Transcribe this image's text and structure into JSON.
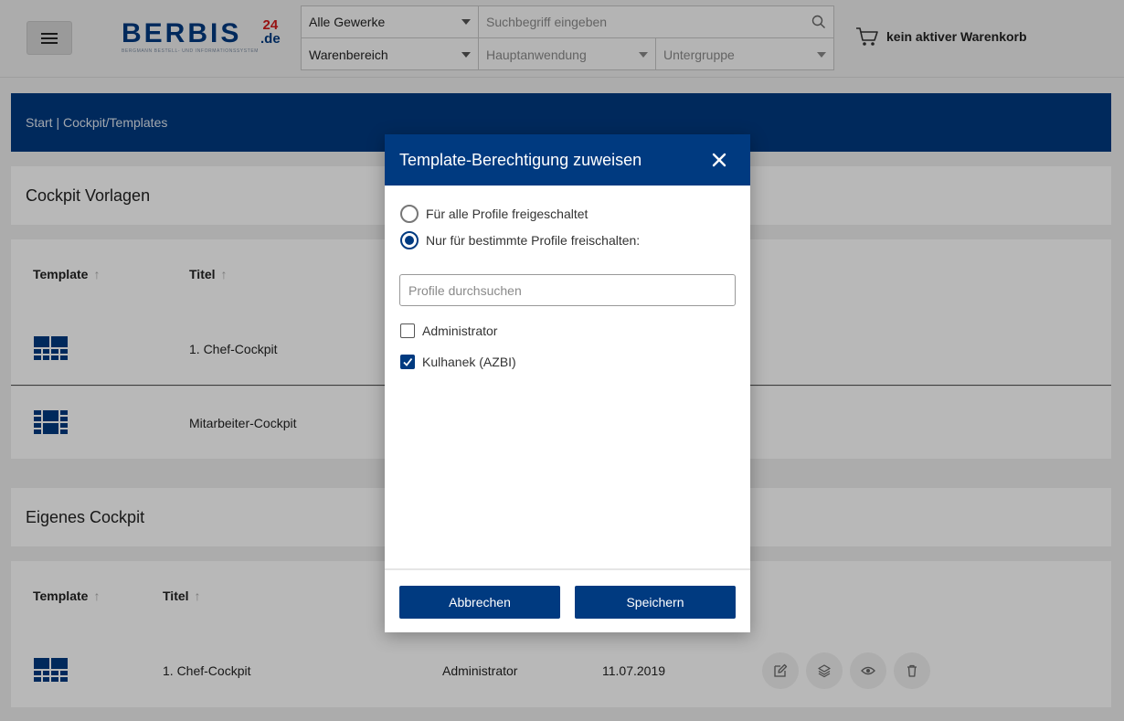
{
  "header": {
    "logo_text": "BERBIS",
    "logo_suffix_top": "24",
    "logo_suffix_bottom": ".de",
    "logo_tagline": "BERGMANN BESTELL- UND INFORMATIONSSYSTEM",
    "search": {
      "gewerke": "Alle Gewerke",
      "search_placeholder": "Suchbegriff eingeben",
      "warenbereich": "Warenbereich",
      "hauptanwendung": "Hauptanwendung",
      "untergruppe": "Untergruppe"
    },
    "cart_label": "kein aktiver Warenkorb"
  },
  "breadcrumb": "Start | Cockpit/Templates",
  "vorlagen": {
    "title": "Cockpit Vorlagen",
    "columns": [
      "Template",
      "Titel"
    ],
    "rows": [
      {
        "titel": "1. Chef-Cockpit"
      },
      {
        "titel": "Mitarbeiter-Cockpit"
      }
    ]
  },
  "eigenes": {
    "title": "Eigenes Cockpit",
    "columns": [
      "Template",
      "Titel"
    ],
    "rows": [
      {
        "titel": "1. Chef-Cockpit",
        "profil": "Administrator",
        "datum": "11.07.2019"
      }
    ]
  },
  "modal": {
    "title": "Template-Berechtigung zuweisen",
    "radio_all": "Für alle Profile freigeschaltet",
    "radio_specific": "Nur für bestimmte Profile freischalten:",
    "selected_radio": "specific",
    "search_placeholder": "Profile durchsuchen",
    "profiles": [
      {
        "name": "Administrator",
        "checked": false
      },
      {
        "name": "Kulhanek (AZBI)",
        "checked": true
      }
    ],
    "cancel_label": "Abbrechen",
    "save_label": "Speichern"
  },
  "colors": {
    "brand": "#003a80",
    "logo_accent": "#d11a1a"
  }
}
